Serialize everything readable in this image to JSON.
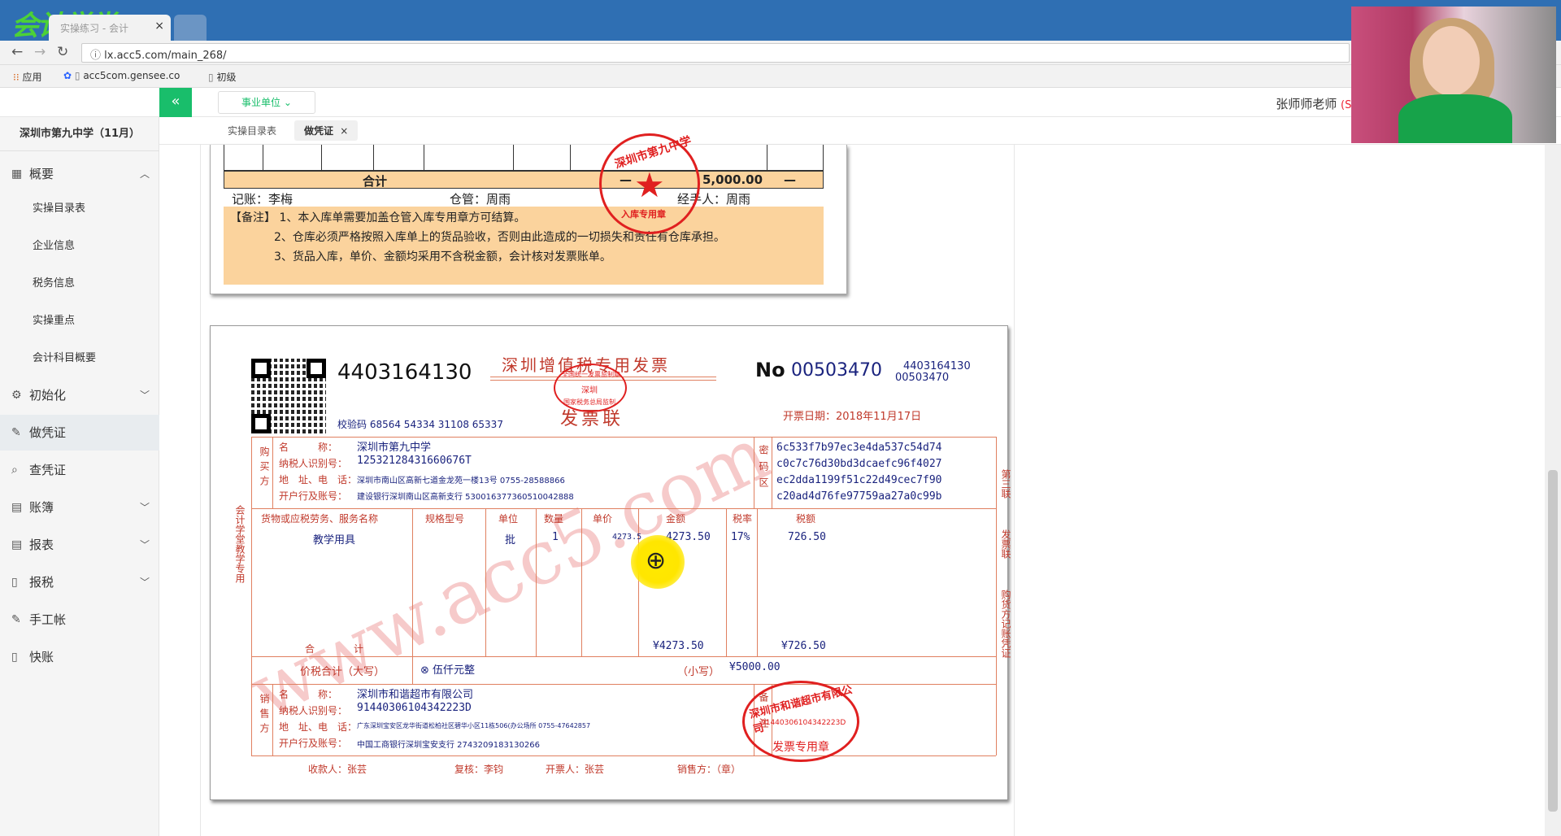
{
  "browser": {
    "tab_label": "实操练习 - 会计",
    "tab_close": "×",
    "url": "lx.acc5.com/main_268/",
    "logo_text": "会计学堂",
    "bookmarks": [
      "应用",
      "acc5com.gensee.co",
      "初级"
    ]
  },
  "header": {
    "unit_select": "事业单位",
    "teacher_name": "张师师老师",
    "vip_label": "(SVIP会员)",
    "collapse_icon": "«"
  },
  "sidebar": {
    "school": "深圳市第九中学（11月）",
    "menu": [
      {
        "label": "概要",
        "icon": "grid-icon",
        "expanded": true
      },
      {
        "label": "初始化",
        "icon": "gear-icon",
        "expanded": false
      },
      {
        "label": "做凭证",
        "icon": "pen-icon",
        "active": true
      },
      {
        "label": "查凭证",
        "icon": "search-icon"
      },
      {
        "label": "账簿",
        "icon": "book-icon",
        "expanded": false
      },
      {
        "label": "报表",
        "icon": "report-icon",
        "expanded": false
      },
      {
        "label": "报税",
        "icon": "file-icon",
        "expanded": false
      },
      {
        "label": "手工帐",
        "icon": "pen-icon"
      },
      {
        "label": "快账",
        "icon": "file-icon"
      }
    ],
    "sub_items": [
      "实操目录表",
      "企业信息",
      "税务信息",
      "实操重点",
      "会计科目概要"
    ]
  },
  "content_tabs": [
    {
      "label": "实操目录表",
      "active": false
    },
    {
      "label": "做凭证",
      "active": true,
      "close": "×"
    }
  ],
  "receipt": {
    "total_label": "合计",
    "total_dash": "—",
    "total_amount": "5,000.00",
    "total_dash2": "—",
    "bookkeeper": "记账：李梅",
    "warehouse": "仓管：周雨",
    "handler": "经手人：周雨",
    "stamp_top": "深圳市第九中学",
    "stamp_bottom": "入库专用章",
    "notes": [
      "【备注】 1、本入库单需要加盖仓管入库专用章方可结算。",
      "2、仓库必须严格按照入库单上的货品验收，否则由此造成的一切损失和责任有仓库承担。",
      "3、货品入库，单价、金额均采用不含税金额，会计核对发票账单。"
    ]
  },
  "invoice": {
    "code": "4403164130",
    "title": "深圳增值税专用发票",
    "subtitle": "发票联",
    "no_label": "No",
    "no": "00503470",
    "code_small": "4403164130",
    "no_small": "00503470",
    "issue_date": "开票日期：2018年11月17日",
    "check_code": "校验码 68564 54334 31108 65337",
    "buyer_side": "购买方",
    "buyer_name_label": "名　　　称：",
    "buyer_name": "深圳市第九中学",
    "buyer_tax_label": "纳税人识别号：",
    "buyer_tax": "12532128431660676T",
    "buyer_addr_label": "地　址、电　话：",
    "buyer_addr": "深圳市南山区高新七道金龙苑一楼13号 0755-28588866",
    "buyer_bank_label": "开户行及账号：",
    "buyer_bank": "建设银行深圳南山区高新支行 530016377360510042888",
    "cipher_side": "密码区",
    "cipher": [
      "6c533f7b97ec3e4da537c54d74",
      "c0c7c76d30bd3dcaefc96f4027",
      "ec2dda1199f51c22d49cec7f90",
      "c20ad4d76fe97759aa27a0c99b"
    ],
    "col_headers": [
      "货物或应税劳务、服务名称",
      "规格型号",
      "单位",
      "数量",
      "单价",
      "金额",
      "税率",
      "税额"
    ],
    "item": {
      "name": "教学用具",
      "spec": "",
      "unit": "批",
      "qty": "1",
      "price": "4273.5",
      "amount": "4273.50",
      "rate": "17%",
      "tax": "726.50"
    },
    "sum_label": "合　　　　计",
    "sum_amount": "¥4273.50",
    "sum_tax": "¥726.50",
    "total_label": "价税合计（大写）",
    "total_upper": "⊗ 伍仟元整",
    "total_lower_label": "（小写）",
    "total_lower": "¥5000.00",
    "seller_side": "销售方",
    "seller_name_label": "名　　　称：",
    "seller_name": "深圳市和谐超市有限公司",
    "seller_tax_label": "纳税人识别号：",
    "seller_tax": "91440306104342223D",
    "seller_addr_label": "地　址、电　话：",
    "seller_addr": "广东深圳宝安区龙华街道松柏社区碧华小区11栋506(办公场所 0755-47642857",
    "seller_bank_label": "开户行及账号：",
    "seller_bank": "中国工商银行深圳宝安支行 274320918313026​6",
    "remark_side": "备注",
    "payee": "收款人：张芸",
    "reviewer": "复核：李钧",
    "drawer": "开票人：张芸",
    "seller_seal": "销售方：（章）",
    "left_vertical": "会计学堂教学专用",
    "right_vertical_1": "第三联",
    "right_vertical_2": "发票联",
    "right_vertical_3": "购货方记账凭证",
    "seal_name": "深圳市和谐超市有限公司",
    "seal_tax": "91440306104342223D",
    "seal_bottom": "发票专用章",
    "header_seal_top": "全国统一发票监制章",
    "header_seal_mid": "深圳",
    "header_seal_bottom": "国家税务总局监制",
    "watermark": "www.acc5.com"
  }
}
